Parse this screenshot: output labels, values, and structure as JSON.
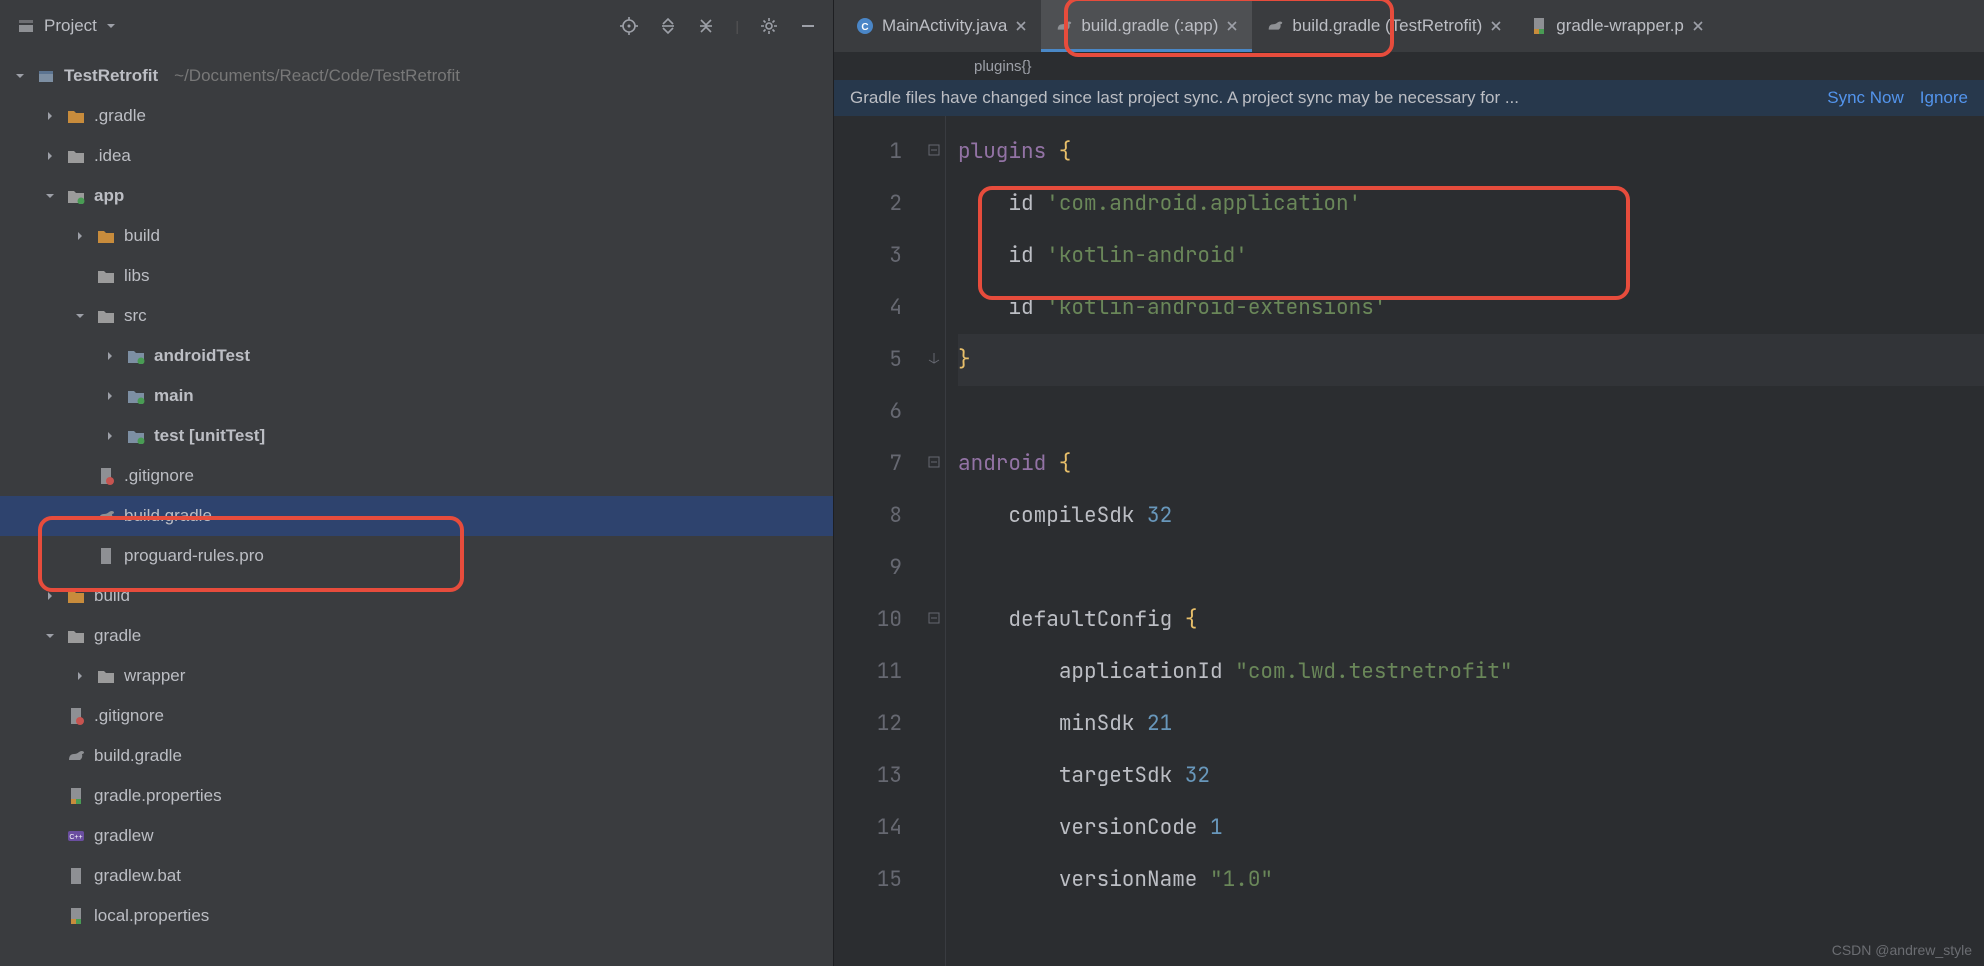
{
  "sidebar": {
    "title": "Project",
    "root": {
      "label": "TestRetrofit",
      "path": "~/Documents/React/Code/TestRetrofit"
    },
    "items": [
      {
        "label": ".gradle",
        "depth": 1,
        "expand": "closed",
        "icon": "folder-orange"
      },
      {
        "label": ".idea",
        "depth": 1,
        "expand": "closed",
        "icon": "folder"
      },
      {
        "label": "app",
        "depth": 1,
        "expand": "open",
        "icon": "folder-green",
        "bold": true
      },
      {
        "label": "build",
        "depth": 2,
        "expand": "closed",
        "icon": "folder-orange"
      },
      {
        "label": "libs",
        "depth": 2,
        "expand": "none",
        "icon": "folder"
      },
      {
        "label": "src",
        "depth": 2,
        "expand": "open",
        "icon": "folder"
      },
      {
        "label": "androidTest",
        "depth": 3,
        "expand": "closed",
        "icon": "folder-test",
        "bold": true
      },
      {
        "label": "main",
        "depth": 3,
        "expand": "closed",
        "icon": "folder-src",
        "bold": true
      },
      {
        "label": "test [unitTest]",
        "depth": 3,
        "expand": "closed",
        "icon": "folder-test",
        "bold": true
      },
      {
        "label": ".gitignore",
        "depth": 2,
        "expand": "none",
        "icon": "git"
      },
      {
        "label": "build.gradle",
        "depth": 2,
        "expand": "none",
        "icon": "gradle",
        "selected": true
      },
      {
        "label": "proguard-rules.pro",
        "depth": 2,
        "expand": "none",
        "icon": "file"
      },
      {
        "label": "build",
        "depth": 1,
        "expand": "closed",
        "icon": "folder-orange"
      },
      {
        "label": "gradle",
        "depth": 1,
        "expand": "open",
        "icon": "folder"
      },
      {
        "label": "wrapper",
        "depth": 2,
        "expand": "closed",
        "icon": "folder"
      },
      {
        "label": ".gitignore",
        "depth": 1,
        "expand": "none",
        "icon": "git"
      },
      {
        "label": "build.gradle",
        "depth": 1,
        "expand": "none",
        "icon": "gradle"
      },
      {
        "label": "gradle.properties",
        "depth": 1,
        "expand": "none",
        "icon": "props"
      },
      {
        "label": "gradlew",
        "depth": 1,
        "expand": "none",
        "icon": "file-cpp"
      },
      {
        "label": "gradlew.bat",
        "depth": 1,
        "expand": "none",
        "icon": "file"
      },
      {
        "label": "local.properties",
        "depth": 1,
        "expand": "none",
        "icon": "props"
      }
    ]
  },
  "tabs": [
    {
      "label": "MainActivity.java",
      "icon": "java",
      "active": false
    },
    {
      "label": "build.gradle (:app)",
      "icon": "gradle",
      "active": true
    },
    {
      "label": "build.gradle (TestRetrofit)",
      "icon": "gradle",
      "active": false
    },
    {
      "label": "gradle-wrapper.p",
      "icon": "props",
      "active": false
    }
  ],
  "breadcrumb": "plugins{}",
  "notification": {
    "text": "Gradle files have changed since last project sync. A project sync may be necessary for ...",
    "sync": "Sync Now",
    "ignore": "Ignore"
  },
  "code": {
    "lines": [
      {
        "n": 1,
        "t": "plugins",
        "rest": " {",
        "kind": "head"
      },
      {
        "n": 2,
        "indent": "    ",
        "id": "id",
        "str": "'com.android.application'"
      },
      {
        "n": 3,
        "indent": "    ",
        "id": "id",
        "str": "'kotlin-android'"
      },
      {
        "n": 4,
        "indent": "    ",
        "id": "id",
        "str": "'kotlin-android-extensions'"
      },
      {
        "n": 5,
        "t": "}",
        "kind": "close",
        "hl": true
      },
      {
        "n": 6,
        "t": "",
        "kind": "blank"
      },
      {
        "n": 7,
        "t": "android",
        "rest": " {",
        "kind": "head"
      },
      {
        "n": 8,
        "indent": "    ",
        "prop": "compileSdk",
        "num": "32"
      },
      {
        "n": 9,
        "t": "",
        "kind": "blank"
      },
      {
        "n": 10,
        "indent": "    ",
        "t": "defaultConfig",
        "rest": " {",
        "kind": "head2"
      },
      {
        "n": 11,
        "indent": "        ",
        "prop": "applicationId",
        "str": "\"com.lwd.testretrofit\""
      },
      {
        "n": 12,
        "indent": "        ",
        "prop": "minSdk",
        "num": "21"
      },
      {
        "n": 13,
        "indent": "        ",
        "prop": "targetSdk",
        "num": "32"
      },
      {
        "n": 14,
        "indent": "        ",
        "prop": "versionCode",
        "num": "1"
      },
      {
        "n": 15,
        "indent": "        ",
        "prop": "versionName",
        "str": "\"1.0\""
      }
    ]
  },
  "watermark": "CSDN @andrew_style"
}
